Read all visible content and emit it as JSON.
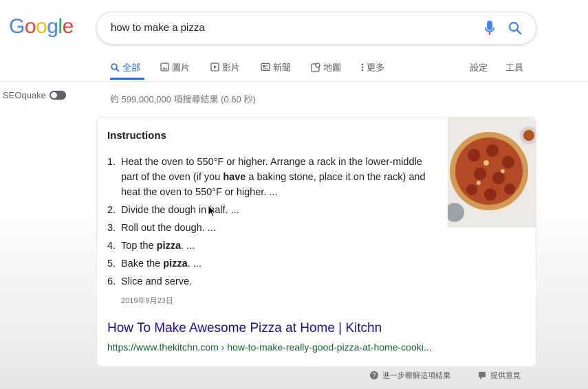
{
  "logo": {
    "letters": [
      "G",
      "o",
      "o",
      "g",
      "l",
      "e"
    ],
    "colors": [
      "#4285F4",
      "#EA4335",
      "#FBBC05",
      "#4285F4",
      "#34A853",
      "#EA4335"
    ]
  },
  "search": {
    "query": "how to make a pizza",
    "mic_icon": "mic-icon",
    "search_icon": "search-icon"
  },
  "tabs": [
    {
      "label": "全部",
      "icon": "search-icon",
      "active": true
    },
    {
      "label": "圖片",
      "icon": "image-icon"
    },
    {
      "label": "影片",
      "icon": "video-icon"
    },
    {
      "label": "新聞",
      "icon": "news-icon"
    },
    {
      "label": "地圖",
      "icon": "map-icon"
    },
    {
      "label": "更多",
      "icon": "more-icon"
    }
  ],
  "tools": {
    "settings": "設定",
    "tools": "工具"
  },
  "seoquake": {
    "label": "SEOquake"
  },
  "results_stats": "約 599,000,000 項搜尋結果 (0.60 秒)",
  "snippet": {
    "heading": "Instructions",
    "steps": [
      {
        "num": "1.",
        "parts": [
          "Heat the oven to 550°F or higher. Arrange a rack in the lower-middle part of the oven (if you ",
          "have",
          " a baking stone, place it on the rack) and heat the oven to 550°F or higher. ..."
        ]
      },
      {
        "num": "2.",
        "parts": [
          "Divide the dough in half. ...",
          "",
          ""
        ]
      },
      {
        "num": "3.",
        "parts": [
          "Roll out the dough. ...",
          "",
          ""
        ]
      },
      {
        "num": "4.",
        "parts": [
          "Top the ",
          "pizza",
          ". ..."
        ]
      },
      {
        "num": "5.",
        "parts": [
          "Bake the ",
          "pizza",
          ". ..."
        ]
      },
      {
        "num": "6.",
        "parts": [
          "Slice and serve.",
          "",
          ""
        ]
      }
    ],
    "date": "2019年9月23日",
    "link_title": "How To Make Awesome Pizza at Home | Kitchn",
    "link_url": "https://www.thekitchn.com › how-to-make-really-good-pizza-at-home-cooki..."
  },
  "footer": {
    "about": "進一步瞭解這項結果",
    "feedback": "提供意見"
  },
  "colors": {
    "accent": "#1a73e8",
    "link": "#1a0dab",
    "url": "#0d652d"
  }
}
